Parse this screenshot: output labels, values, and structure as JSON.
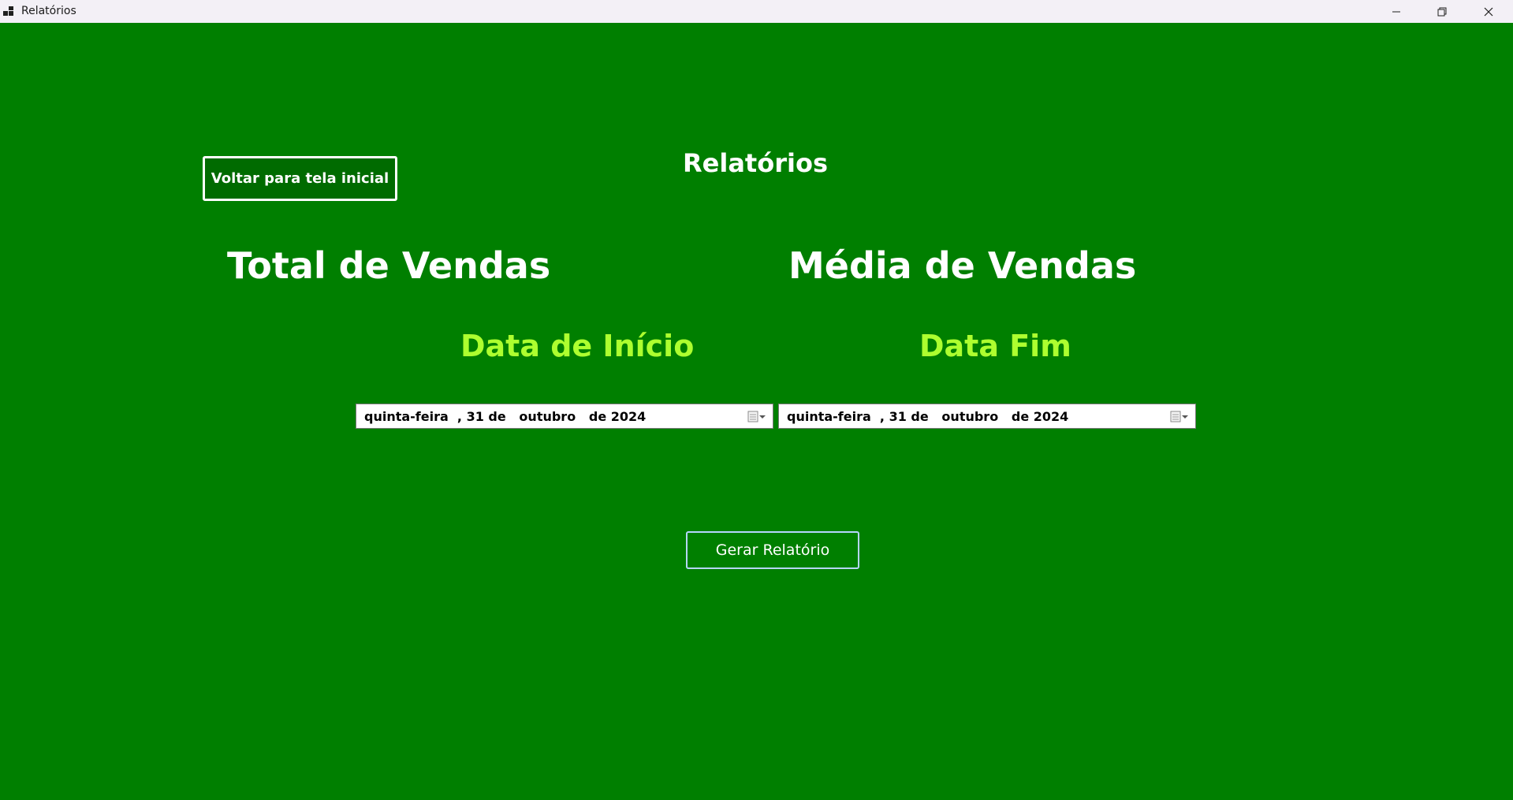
{
  "window": {
    "title": "Relatórios",
    "app_icon": "app-grid-icon",
    "controls": {
      "minimize_icon": "minimize-icon",
      "restore_icon": "restore-icon",
      "close_icon": "close-icon"
    }
  },
  "colors": {
    "background": "#007f00",
    "label_white": "#ffffff",
    "label_lime": "#adff2f"
  },
  "header": {
    "back_button_label": "Voltar para tela inicial",
    "page_title": "Relatórios"
  },
  "stats": {
    "total_label": "Total de Vendas",
    "average_label": "Média de Vendas"
  },
  "dates": {
    "start_label": "Data de Início",
    "end_label": "Data Fim",
    "start_value": "quinta-feira  , 31 de   outubro   de 2024",
    "end_value": "quinta-feira  , 31 de   outubro   de 2024",
    "dropdown_icon": "calendar-dropdown-icon"
  },
  "actions": {
    "generate_label": "Gerar Relatório"
  }
}
